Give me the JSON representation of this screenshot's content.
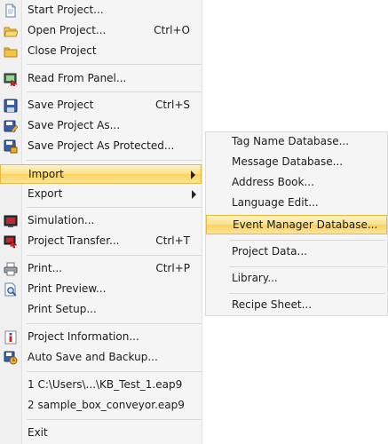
{
  "menu": {
    "items": [
      {
        "label": "Start Project...",
        "icon": "new-document-icon"
      },
      {
        "label": "Open Project...",
        "shortcut": "Ctrl+O",
        "icon": "open-folder-icon"
      },
      {
        "label": "Close Project",
        "icon": "close-folder-icon"
      },
      {
        "label": "Read From Panel...",
        "icon": "read-from-panel-icon"
      },
      {
        "label": "Save Project",
        "shortcut": "Ctrl+S",
        "icon": "save-icon"
      },
      {
        "label": "Save Project As...",
        "icon": "save-as-icon"
      },
      {
        "label": "Save Project As Protected...",
        "icon": "save-protected-icon"
      },
      {
        "label": "Import",
        "icon": "",
        "highlighted": true,
        "has_submenu": true
      },
      {
        "label": "Export",
        "icon": "",
        "has_submenu": true
      },
      {
        "label": "Simulation...",
        "icon": "simulation-icon"
      },
      {
        "label": "Project Transfer...",
        "shortcut": "Ctrl+T",
        "icon": "transfer-icon"
      },
      {
        "label": "Print...",
        "shortcut": "Ctrl+P",
        "icon": "printer-icon"
      },
      {
        "label": "Print Preview...",
        "icon": "print-preview-icon"
      },
      {
        "label": "Print Setup...",
        "icon": ""
      },
      {
        "label": "Project Information...",
        "icon": "info-icon"
      },
      {
        "label": "Auto Save and Backup...",
        "icon": "auto-save-icon"
      },
      {
        "label": "1 C:\\Users\\...\\KB_Test_1.eap9",
        "icon": ""
      },
      {
        "label": "2 sample_box_conveyor.eap9",
        "icon": ""
      },
      {
        "label": "Exit",
        "icon": ""
      }
    ]
  },
  "submenu": {
    "items": [
      {
        "label": "Tag Name Database..."
      },
      {
        "label": "Message Database..."
      },
      {
        "label": "Address Book..."
      },
      {
        "label": "Language Edit..."
      },
      {
        "label": "Event Manager Database...",
        "highlighted": true
      },
      {
        "label": "Project Data..."
      },
      {
        "label": "Library..."
      },
      {
        "label": "Recipe Sheet..."
      }
    ]
  },
  "colors": {
    "highlight": "#fbe08a",
    "highlight_border": "#e7b93c",
    "menu_bg": "#f5f5f5"
  }
}
